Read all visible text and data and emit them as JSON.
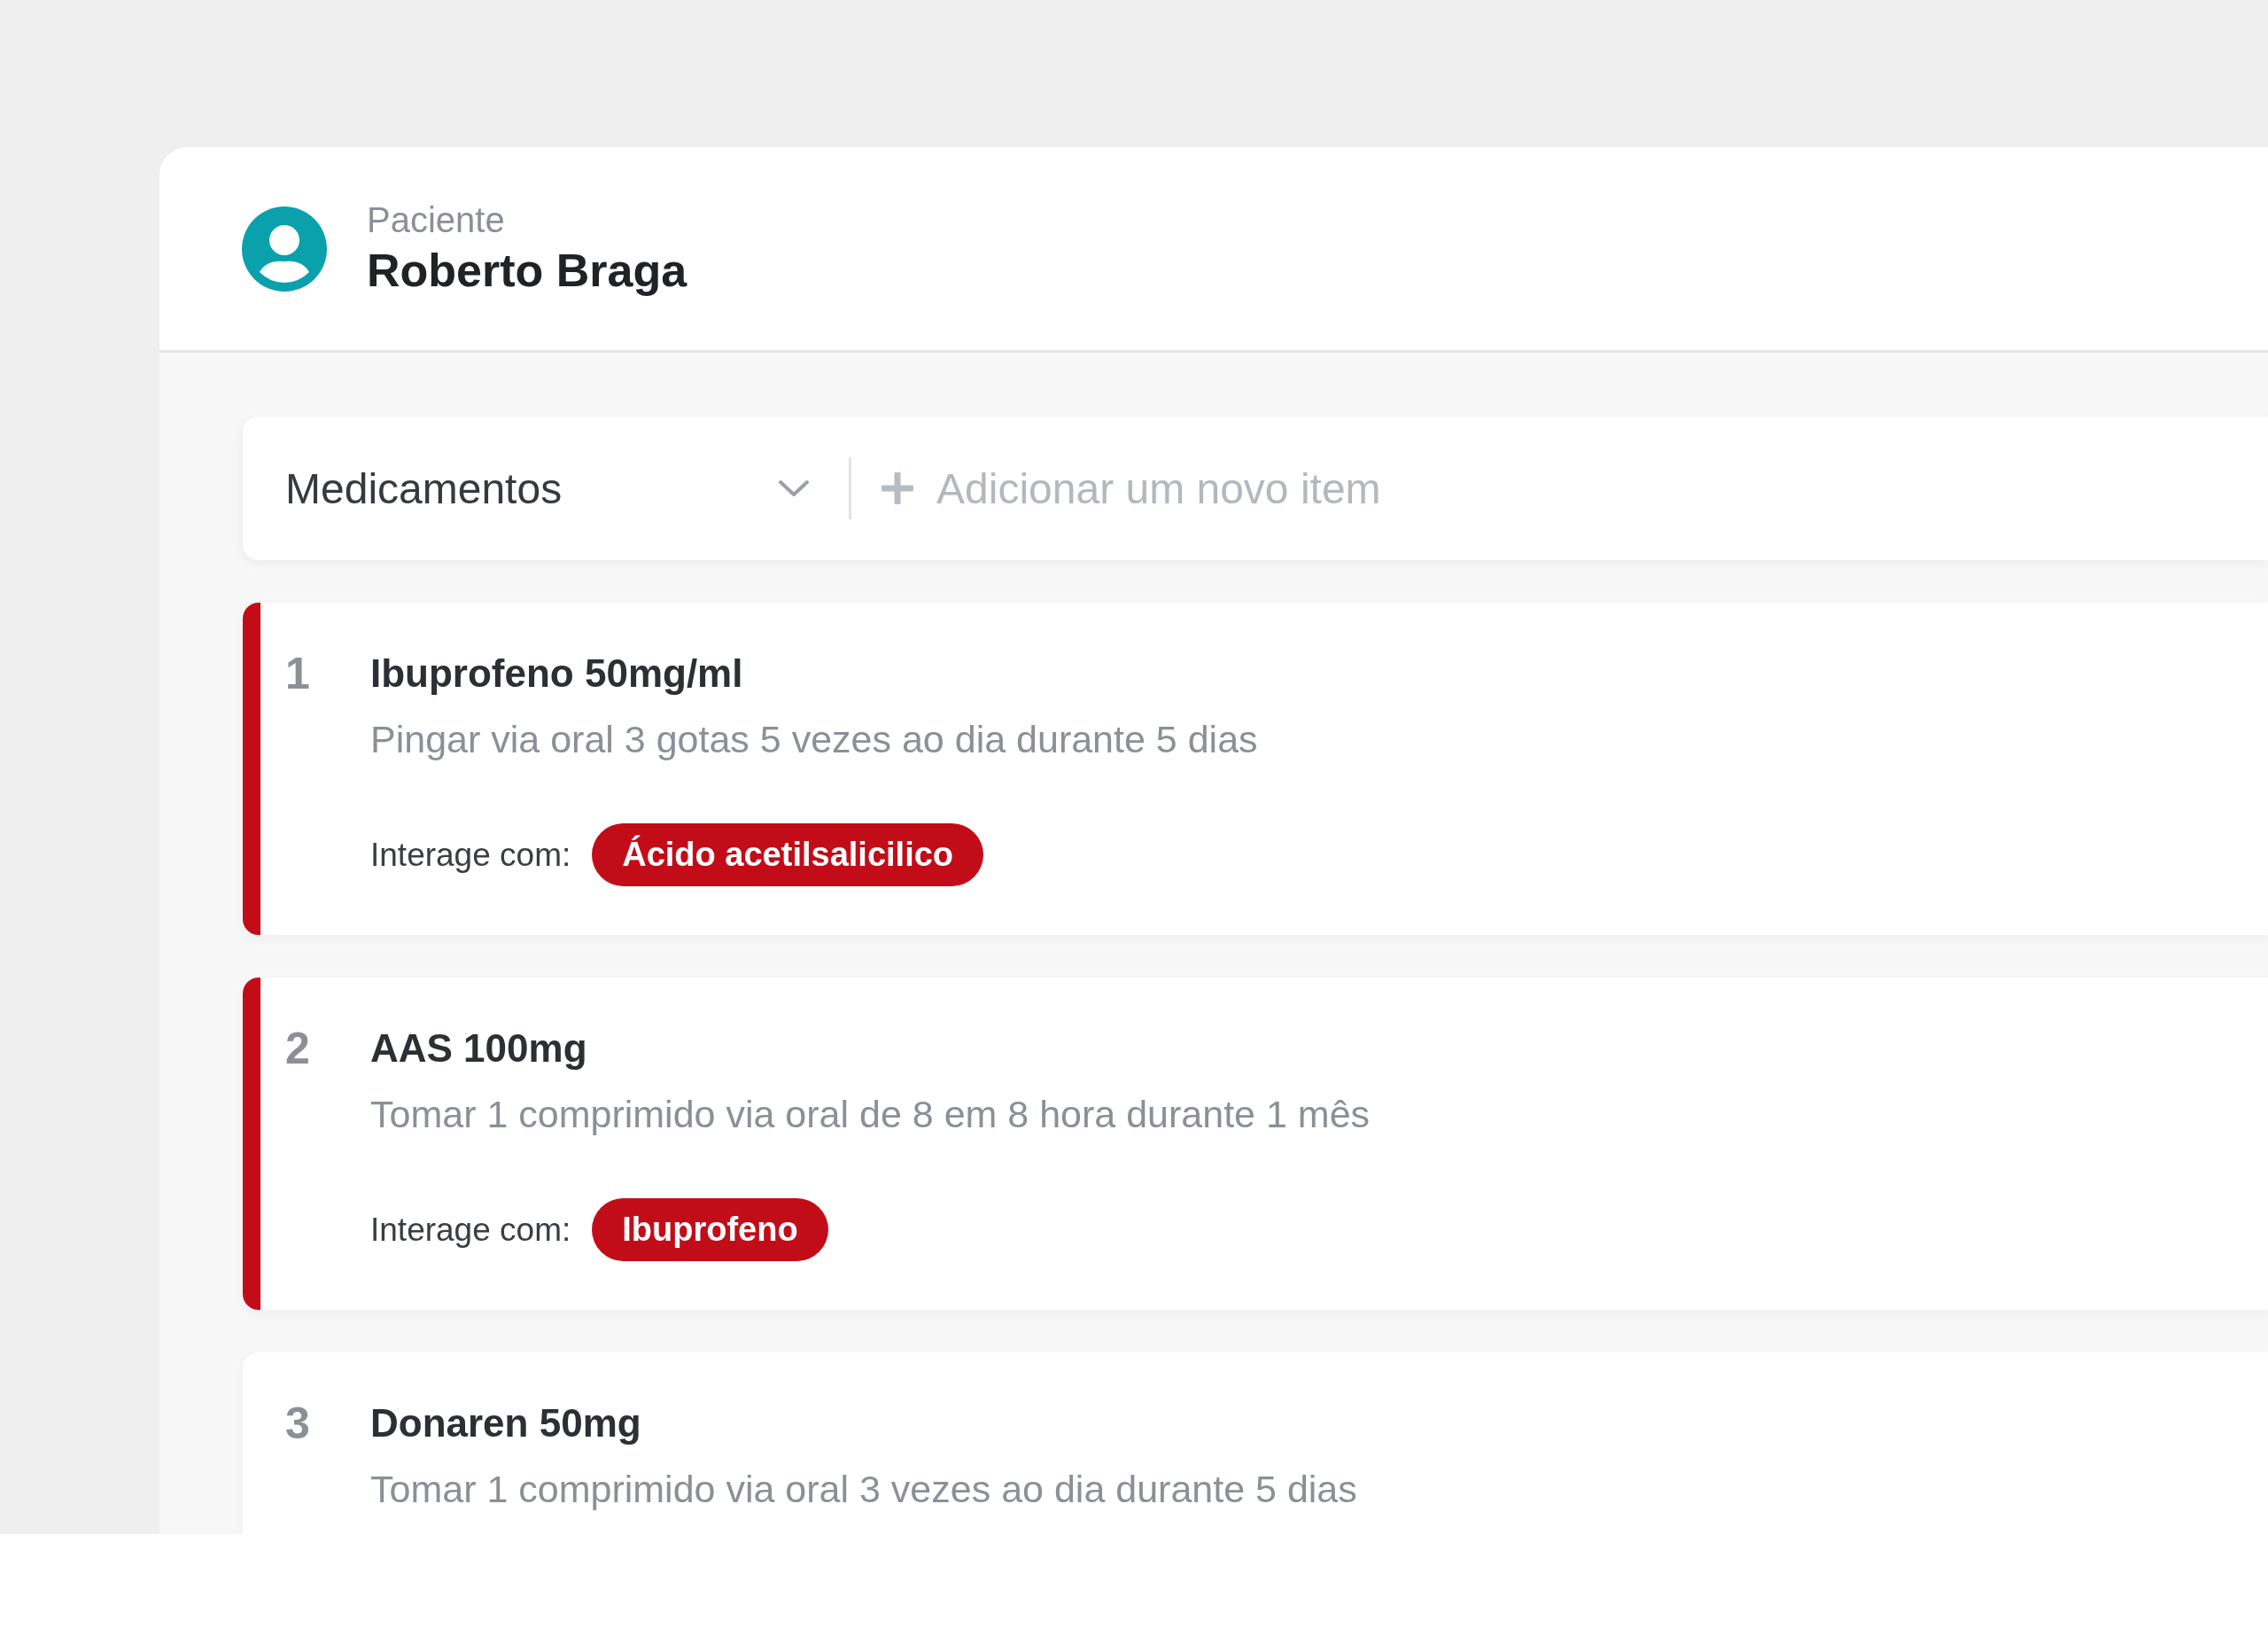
{
  "patient": {
    "label": "Paciente",
    "name": "Roberto Braga"
  },
  "category_bar": {
    "category": "Medicamentos",
    "add_placeholder": "Adicionar um novo item"
  },
  "items": [
    {
      "number": "1",
      "name": "Ibuprofeno 50mg/ml",
      "instructions": "Pingar via oral 3 gotas 5 vezes ao dia durante 5 dias",
      "alert": true,
      "interaction_label": "Interage com:",
      "interacts_with": "Ácido acetilsalicilico"
    },
    {
      "number": "2",
      "name": "AAS 100mg",
      "instructions": "Tomar 1 comprimido via oral de 8 em 8 hora durante 1 mês",
      "alert": true,
      "interaction_label": "Interage com:",
      "interacts_with": "Ibuprofeno"
    },
    {
      "number": "3",
      "name": "Donaren 50mg",
      "instructions": "Tomar 1 comprimido via oral 3 vezes ao dia durante 5 dias",
      "alert": false
    }
  ]
}
